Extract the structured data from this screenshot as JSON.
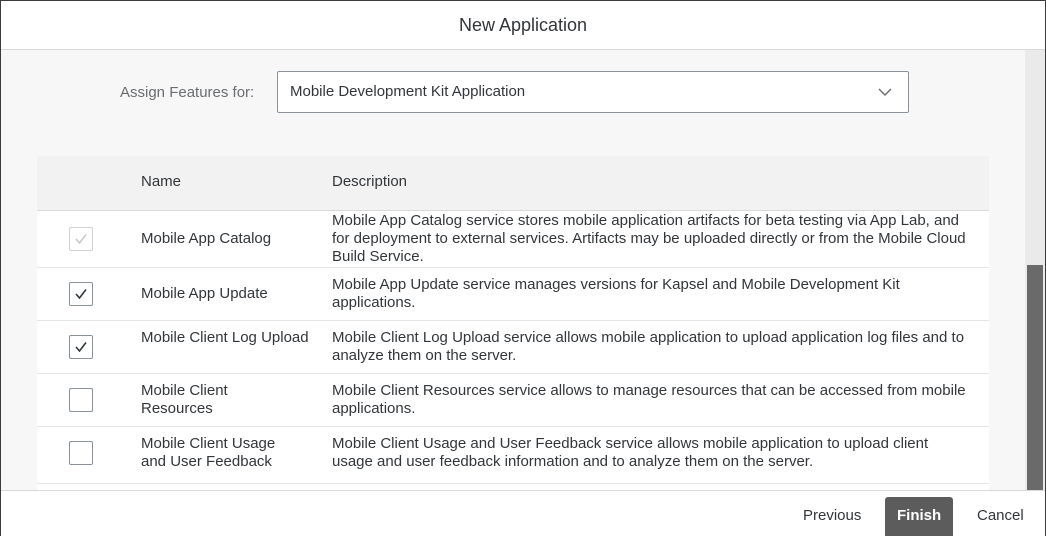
{
  "dialog": {
    "title": "New Application"
  },
  "assign": {
    "label": "Assign Features for:",
    "selected": "Mobile Development Kit Application"
  },
  "table": {
    "columns": [
      "Name",
      "Description"
    ],
    "rows": [
      {
        "name": "Mobile App Catalog",
        "description": "Mobile App Catalog service stores mobile application artifacts for beta testing via App Lab, and for deployment to external services. Artifacts may be uploaded directly or from the Mobile Cloud Build Service.",
        "checked": true,
        "disabled": true
      },
      {
        "name": "Mobile App Update",
        "description": "Mobile App Update service manages versions for Kapsel and Mobile Development Kit applications.",
        "checked": true,
        "disabled": false
      },
      {
        "name": "Mobile Client Log Upload",
        "description": "Mobile Client Log Upload service allows mobile application to upload application log files and to analyze them on the server.",
        "checked": true,
        "disabled": false
      },
      {
        "name": "Mobile Client Resources",
        "description": "Mobile Client Resources service allows to manage resources that can be accessed from mobile applications.",
        "checked": false,
        "disabled": false
      },
      {
        "name": "Mobile Client Usage and User Feedback",
        "description": "Mobile Client Usage and User Feedback service allows mobile application to upload client usage and user feedback information and to analyze them on the server.",
        "checked": false,
        "disabled": false
      }
    ]
  },
  "footer": {
    "previous": "Previous",
    "finish": "Finish",
    "cancel": "Cancel"
  }
}
